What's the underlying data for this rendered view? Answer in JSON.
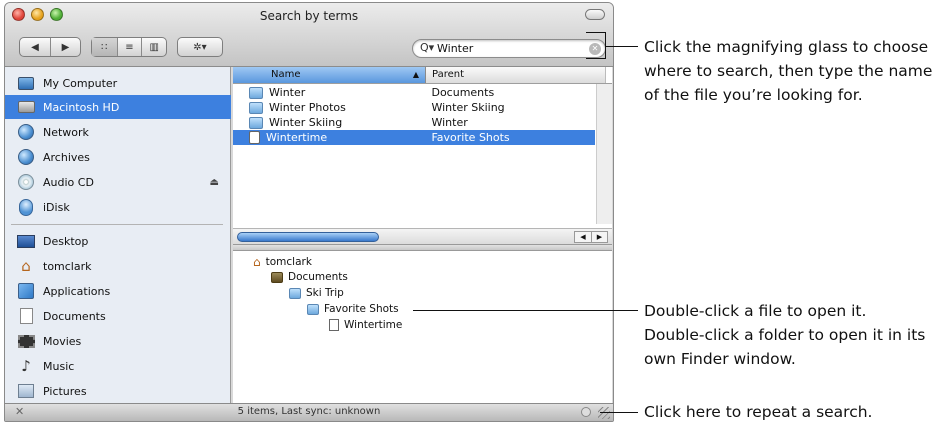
{
  "window": {
    "title": "Search by terms"
  },
  "toolbar": {
    "nav_back": "◀",
    "nav_forward": "▶",
    "view_icon": "∷",
    "view_list": "≡",
    "view_column": "▥",
    "action_menu": "✲▾"
  },
  "search": {
    "icon": "magnifying-glass",
    "glyph": "Q▾",
    "value": "Winter"
  },
  "sidebar": {
    "items": [
      {
        "label": "My Computer",
        "icon": "monitor-icon"
      },
      {
        "label": "Macintosh HD",
        "icon": "hard-disk-icon",
        "selected": true
      },
      {
        "label": "Network",
        "icon": "globe-icon"
      },
      {
        "label": "Archives",
        "icon": "globe-icon"
      },
      {
        "label": "Audio CD",
        "icon": "cd-icon"
      },
      {
        "label": "iDisk",
        "icon": "idisk-icon"
      }
    ],
    "eject": "⏏",
    "places": [
      {
        "label": "Desktop",
        "icon": "desktop-icon"
      },
      {
        "label": "tomclark",
        "icon": "home-icon"
      },
      {
        "label": "Applications",
        "icon": "applications-icon"
      },
      {
        "label": "Documents",
        "icon": "document-icon"
      },
      {
        "label": "Movies",
        "icon": "movie-icon"
      },
      {
        "label": "Music",
        "icon": "music-icon"
      },
      {
        "label": "Pictures",
        "icon": "pictures-icon"
      }
    ]
  },
  "results": {
    "columns": {
      "name": "Name",
      "parent": "Parent"
    },
    "rows": [
      {
        "name": "Winter",
        "parent": "Documents"
      },
      {
        "name": "Winter Photos",
        "parent": "Winter Skiing"
      },
      {
        "name": "Winter Skiing",
        "parent": "Winter"
      },
      {
        "name": "Wintertime",
        "parent": "Favorite Shots",
        "selected": true
      }
    ]
  },
  "path": [
    "tomclark",
    "Documents",
    "Ski Trip",
    "Favorite Shots",
    "Wintertime"
  ],
  "status": {
    "text": "5 items, Last sync: unknown"
  },
  "callouts": {
    "search": [
      "Click the magnifying glass to choose",
      "where to search, then type the name",
      "of the file you’re looking for."
    ],
    "open": [
      "Double-click a file to open it.",
      "Double-click a folder to open it in its",
      "own Finder window."
    ],
    "repeat": [
      "Click here to repeat a search."
    ]
  },
  "colors": {
    "selection": "#3d80df",
    "sidebar_bg": "#e8edf4"
  }
}
